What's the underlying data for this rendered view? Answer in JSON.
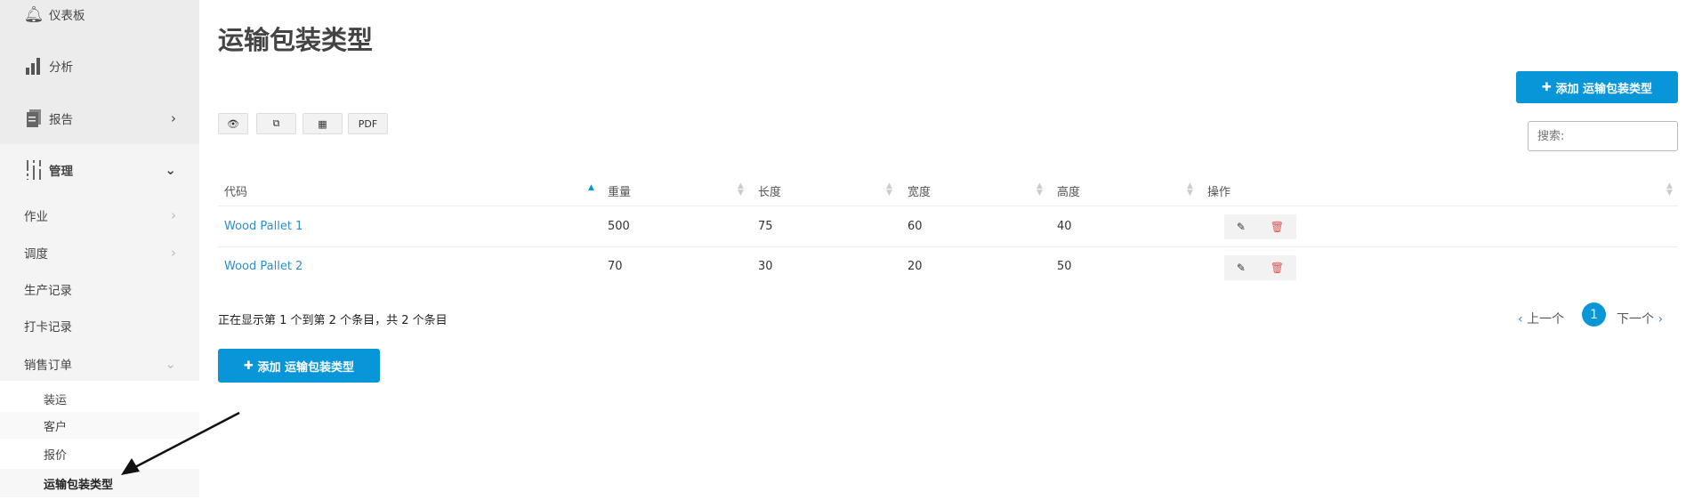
{
  "sidebar": {
    "items": [
      {
        "label": "仪表板",
        "icon": "bell-icon"
      },
      {
        "label": "分析",
        "icon": "bar-chart-icon"
      },
      {
        "label": "报告",
        "icon": "report-icon"
      },
      {
        "label": "管理",
        "icon": "sliders-icon"
      },
      {
        "label": "作业"
      },
      {
        "label": "调度"
      },
      {
        "label": "生产记录"
      },
      {
        "label": "打卡记录"
      },
      {
        "label": "销售订单"
      }
    ],
    "subitems": [
      {
        "label": "装运"
      },
      {
        "label": "客户"
      },
      {
        "label": "报价"
      },
      {
        "label": "运输包装类型"
      }
    ]
  },
  "page": {
    "title": "运输包装类型",
    "add_label": "添加 运输包装类型",
    "search_placeholder": "搜索:"
  },
  "toolbar": {
    "pdf_label": "PDF"
  },
  "table": {
    "headers": [
      "代码",
      "重量",
      "长度",
      "宽度",
      "高度",
      "操作"
    ],
    "rows": [
      {
        "code": "Wood Pallet 1",
        "weight": "500",
        "length": "75",
        "width": "60",
        "height": "40"
      },
      {
        "code": "Wood Pallet 2",
        "weight": "70",
        "length": "30",
        "width": "20",
        "height": "50"
      }
    ]
  },
  "footer": {
    "info": "正在显示第 1 个到第 2 个条目，共 2 个条目",
    "prev": "上一个",
    "page": "1",
    "next": "下一个"
  },
  "colors": {
    "accent": "#0996d8",
    "link": "#2a8fd0",
    "delete": "#e05555"
  }
}
